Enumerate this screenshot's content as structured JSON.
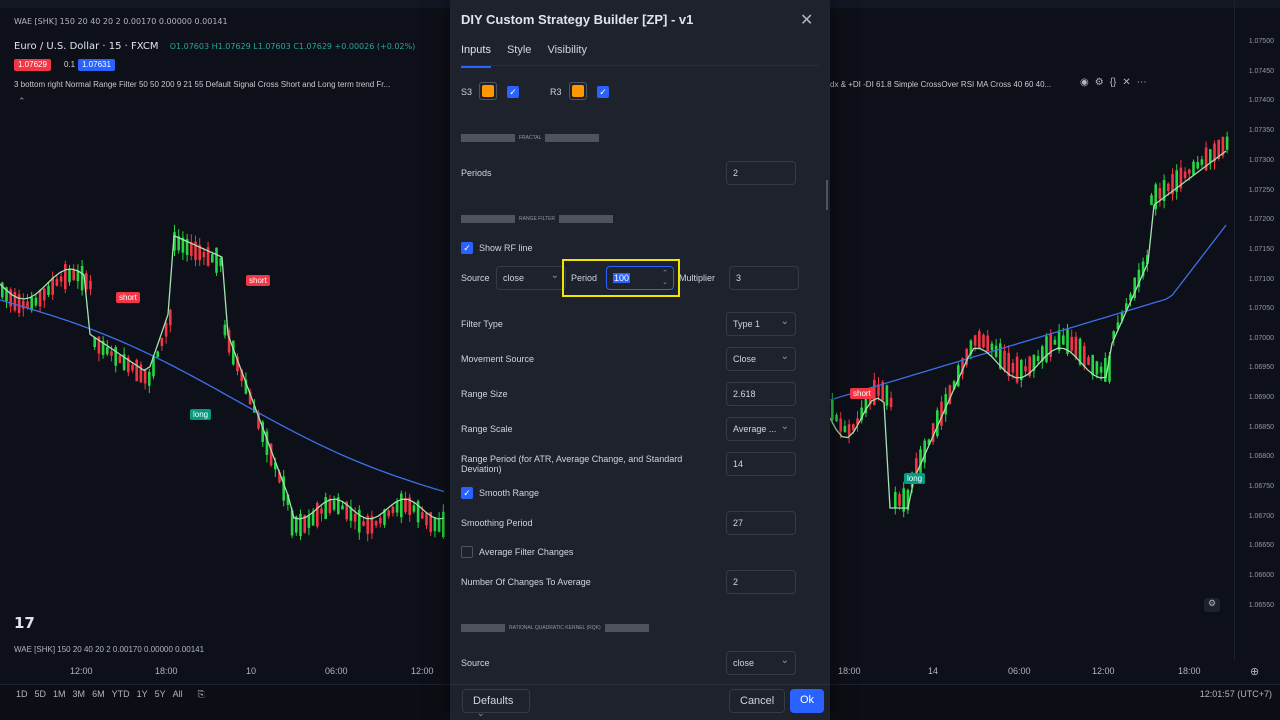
{
  "left_chart": {
    "wae_top": "WAE [SHK] 150 20 40 20 2  0.00170  0.00000  0.00141",
    "symbol": "Euro / U.S. Dollar · 15 · FXCM",
    "ohlc": "O1.07603 H1.07629 L1.07603 C1.07629 +0.00026 (+0.02%)",
    "price_chip_1": "1.07629",
    "price_chip_2": "0.1",
    "price_chip_3": "1.07631",
    "indicator_line": "3 bottom right Normal Range Filter 50 50 200 9 21 55 Default Signal Cross Short and Long term trend Fr...",
    "short_1": "short",
    "short_2": "short",
    "long_1": "long",
    "wae_bottom": "WAE [SHK] 150 20 40 20 2  0.00170  0.00000  0.00141",
    "times": [
      "12:00",
      "18:00",
      "10",
      "06:00",
      "12:00"
    ],
    "logo": "17"
  },
  "right_chart": {
    "indicator_line": "dx & +DI -DI 61.8 Simple CrossOver RSI MA Cross 40 60 40...",
    "short_1": "short",
    "long_1": "long",
    "times": [
      "18:00",
      "14",
      "06:00",
      "12:00",
      "18:00"
    ],
    "prices": [
      "1.07500",
      "1.07450",
      "1.07400",
      "1.07350",
      "1.07300",
      "1.07250",
      "1.07200",
      "1.07150",
      "1.07100",
      "1.07050",
      "1.07000",
      "1.06950",
      "1.06900",
      "1.06850",
      "1.06800",
      "1.06750",
      "1.06700",
      "1.06650",
      "1.06600",
      "1.06550"
    ],
    "clock": "12:01:57 (UTC+7)"
  },
  "timeframes": [
    "1D",
    "5D",
    "1M",
    "3M",
    "6M",
    "YTD",
    "1Y",
    "5Y",
    "All"
  ],
  "dialog": {
    "title": "DIY Custom Strategy Builder [ZP] - v1",
    "tabs": [
      "Inputs",
      "Style",
      "Visibility"
    ],
    "s3_label": "S3",
    "r3_label": "R3",
    "section_fractal": "FRACTAL",
    "periods_label": "Periods",
    "periods_value": "2",
    "section_range_filter": "RANGE FILTER",
    "show_rf_label": "Show RF line",
    "source_label": "Source",
    "source_value": "close",
    "period_label": "Period",
    "period_value": "100",
    "multiplier_label": "Multiplier",
    "multiplier_value": "3",
    "filter_type_label": "Filter Type",
    "filter_type_value": "Type 1",
    "movement_source_label": "Movement Source",
    "movement_source_value": "Close",
    "range_size_label": "Range Size",
    "range_size_value": "2.618",
    "range_scale_label": "Range Scale",
    "range_scale_value": "Average ...",
    "range_period_label": "Range Period (for ATR, Average Change, and Standard Deviation)",
    "range_period_value": "14",
    "smooth_range_label": "Smooth Range",
    "smoothing_period_label": "Smoothing Period",
    "smoothing_period_value": "27",
    "avg_filter_label": "Average Filter Changes",
    "num_changes_label": "Number Of Changes To Average",
    "num_changes_value": "2",
    "section_rqk": "RATIONAL QUADRATIC KERNEL (RQK)",
    "rqk_source_label": "Source",
    "rqk_source_value": "close",
    "defaults_label": "Defaults",
    "cancel_label": "Cancel",
    "ok_label": "Ok"
  },
  "colors": {
    "bull": "#26d642",
    "bear": "#f23645",
    "accent": "#2962ff",
    "highlight": "#f2e600",
    "swatch": "#ff9800"
  }
}
